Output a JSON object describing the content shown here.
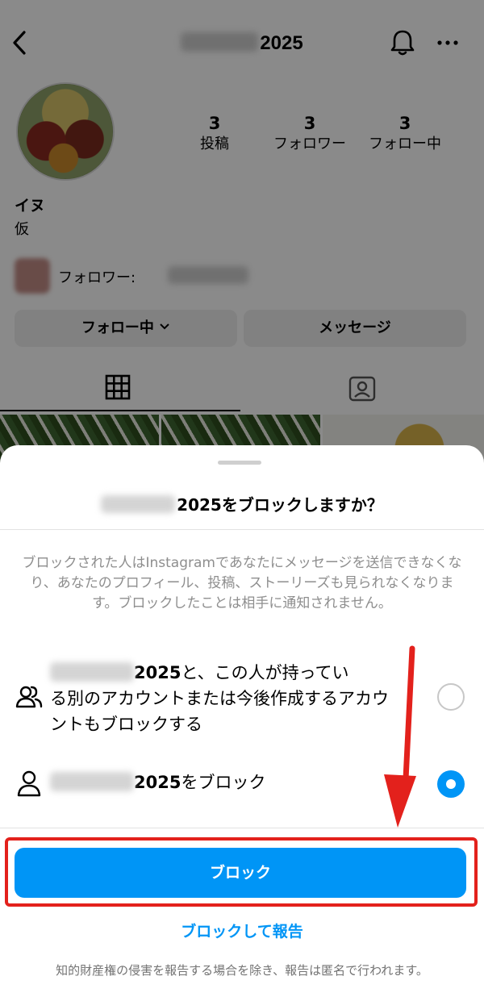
{
  "profile": {
    "username_suffix": "2025",
    "stats": [
      {
        "value": "3",
        "label": "投稿"
      },
      {
        "value": "3",
        "label": "フォロワー"
      },
      {
        "value": "3",
        "label": "フォロー中"
      }
    ],
    "display_name": "イヌ",
    "bio": "仮",
    "followed_by_label": "フォロワー:",
    "following_button": "フォロー中",
    "message_button": "メッセージ"
  },
  "sheet": {
    "title_suffix": "2025をブロックしますか？",
    "description": "ブロックされた人はInstagramであなたにメッセージを送信できなくなり、あなたのプロフィール、投稿、ストーリーズも見られなくなります。ブロックしたことは相手に通知されません。",
    "options": [
      {
        "name": "2025",
        "text_line1": "と、この人が持ってい",
        "text_rest": "る別のアカウントまたは今後作成するアカウントもブロックする",
        "selected": false
      },
      {
        "name": "2025",
        "text": "をブロック",
        "selected": true
      }
    ],
    "block_button": "ブロック",
    "block_and_report": "ブロックして報告",
    "footnote": "知的財産権の侵害を報告する場合を除き、報告は匿名で行われます。"
  },
  "colors": {
    "accent": "#0095f6",
    "annotation": "#e3211c"
  }
}
